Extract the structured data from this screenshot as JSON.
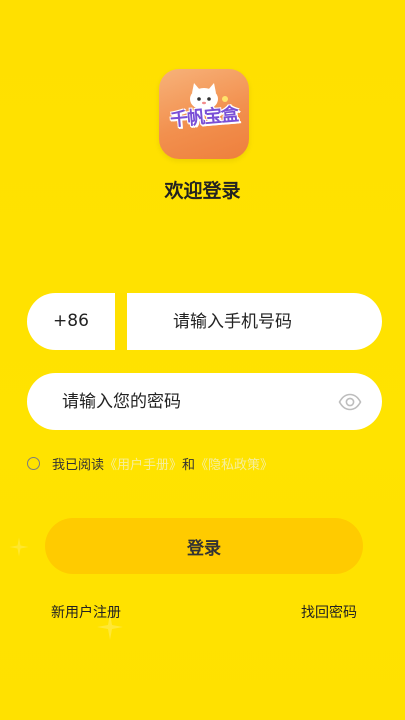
{
  "app": {
    "logo_text": "千帆宝盒",
    "title": "欢迎登录"
  },
  "phone": {
    "country_code": "+86",
    "placeholder": "请输入手机号码"
  },
  "password": {
    "placeholder": "请输入您的密码"
  },
  "agreement": {
    "prefix": "我已阅读",
    "user_manual": "《用户手册》",
    "conjunction": "和",
    "privacy_policy": "《隐私政策》"
  },
  "actions": {
    "login_label": "登录",
    "register_label": "新用户注册",
    "forgot_label": "找回密码"
  },
  "colors": {
    "background": "#FFE000",
    "button": "#FFCB00",
    "link": "#F6EE9C"
  },
  "icons": {
    "password_toggle": "eye-icon"
  }
}
